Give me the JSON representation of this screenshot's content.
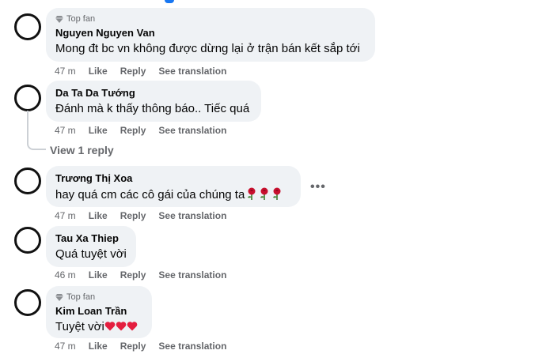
{
  "comments": [
    {
      "badge": "Top fan",
      "author": "Nguyen Nguyen Van",
      "text": "Mong đt bc vn không được dừng lại ở trận bán kết sắp tới",
      "time": "47 m",
      "like": "Like",
      "reply": "Reply",
      "translate": "See translation"
    },
    {
      "author": "Da Ta Da Tướng",
      "text": "Đánh mà k thấy thông báo.. Tiếc quá",
      "time": "47 m",
      "like": "Like",
      "reply": "Reply",
      "translate": "See translation",
      "view_replies": "View 1 reply"
    },
    {
      "author": "Trương Thị Xoa",
      "text": "hay quá cm các cô gái của chúng ta",
      "time": "47 m",
      "like": "Like",
      "reply": "Reply",
      "translate": "See translation",
      "more": "•••"
    },
    {
      "author": "Tau Xa Thiep",
      "text": "Quá tuyệt vời",
      "time": "46 m",
      "like": "Like",
      "reply": "Reply",
      "translate": "See translation"
    },
    {
      "badge": "Top fan",
      "author": "Kim Loan Trần",
      "text": "Tuyệt vời",
      "time": "47 m",
      "like": "Like",
      "reply": "Reply",
      "translate": "See translation"
    }
  ],
  "colors": {
    "bubble": "#eff2f5",
    "meta": "#65676b",
    "heart": "#e41e3f",
    "rose": "#c8102e"
  },
  "icons": {
    "badge": "diamond-icon",
    "rose": "rose-emoji",
    "heart": "heart-emoji",
    "more": "more-options-icon"
  }
}
